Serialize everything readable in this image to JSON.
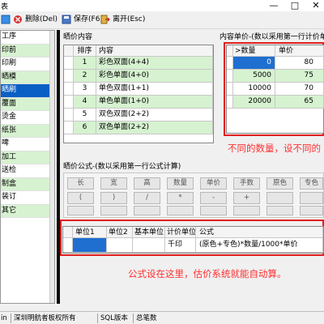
{
  "window": {
    "title_fragment": "表",
    "minimize": "—",
    "maximize": "□",
    "close": "✕"
  },
  "toolbar": {
    "delete_label": "删除(Del)",
    "save_label": "保存(F6)",
    "exit_label": "离开(Esc)"
  },
  "sidebar": {
    "items": [
      {
        "label": "工序"
      },
      {
        "label": "印前"
      },
      {
        "label": "印刷"
      },
      {
        "label": "晒模"
      },
      {
        "label": "晒刷"
      },
      {
        "label": "覆面"
      },
      {
        "label": "烫金"
      },
      {
        "label": "纸张"
      },
      {
        "label": "啤"
      },
      {
        "label": "加工"
      },
      {
        "label": "送检"
      },
      {
        "label": "制盒"
      },
      {
        "label": "装订"
      },
      {
        "label": "其它"
      }
    ]
  },
  "pricing_list": {
    "title": "晒价内容",
    "headers": [
      "排序",
      "内容"
    ],
    "rows": [
      {
        "order": "1",
        "content": "彩色双面(4+4)"
      },
      {
        "order": "2",
        "content": "彩色单面(4+0)"
      },
      {
        "order": "3",
        "content": "单色双面(1+1)"
      },
      {
        "order": "4",
        "content": "单色单面(1+0)"
      },
      {
        "order": "5",
        "content": "双色双面(2+2)"
      },
      {
        "order": "6",
        "content": "双色单面(2+2)"
      }
    ]
  },
  "unit_price": {
    "title": "内容单价-(数以采用第一行计价单位",
    "headers": [
      ">数量",
      "单价"
    ],
    "rows": [
      {
        "qty": "0",
        "price": "80"
      },
      {
        "qty": "5000",
        "price": "75"
      },
      {
        "qty": "10000",
        "price": "70"
      },
      {
        "qty": "20000",
        "price": "65"
      }
    ],
    "annotation": "不同的数量，设不同的"
  },
  "formula": {
    "title": "晒价公式-(数以采用第一行公式计算)",
    "buttons_row1": [
      "长",
      "宽",
      "高",
      "数量",
      "单价",
      "手数",
      "原色",
      "专色"
    ],
    "buttons_row2": [
      "(",
      ")",
      "/",
      "*",
      "-",
      "+",
      "",
      ""
    ],
    "headers": [
      "单位1",
      "单位2",
      "基本单位",
      "计价单位",
      "公式"
    ],
    "row": {
      "unit1": "",
      "unit2": "",
      "base_unit": "",
      "price_unit": "千印",
      "formula": "(原色+专色)*数量/1000*单价"
    },
    "annotation": "公式设在这里，估价系统就能自动算。"
  },
  "status": {
    "items": [
      "in",
      "深圳明航者板权所有",
      "SQL版本",
      "总笔数"
    ]
  }
}
